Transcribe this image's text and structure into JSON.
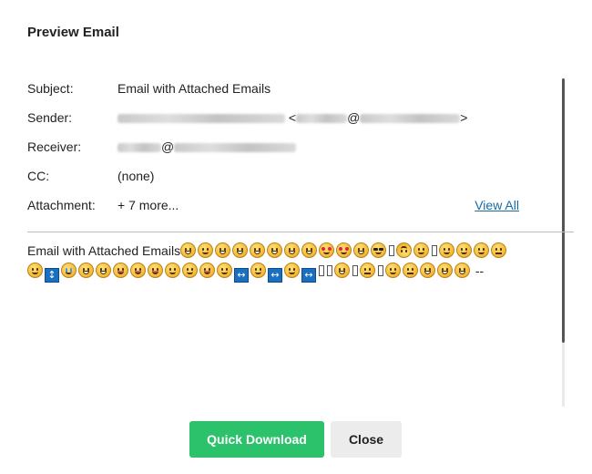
{
  "dialog": {
    "title": "Preview Email"
  },
  "meta": {
    "subject_label": "Subject:",
    "subject_value": "Email with Attached Emails",
    "sender_label": "Sender:",
    "sender_value_mid": " <",
    "sender_value_at": "@",
    "sender_value_end": ">",
    "receiver_label": "Receiver:",
    "receiver_at": "@",
    "cc_label": "CC:",
    "cc_value": "(none)",
    "attachment_label": "Attachment:",
    "attachment_value": "+ 7 more...",
    "view_all": "View All"
  },
  "body": {
    "intro": "Email with Attached Emails",
    "trailer": " --"
  },
  "footer": {
    "download_label": "Quick Download",
    "close_label": "Close"
  },
  "colors": {
    "primary": "#2cc26c",
    "link": "#1a6aa6",
    "secondary_bg": "#ececec"
  }
}
